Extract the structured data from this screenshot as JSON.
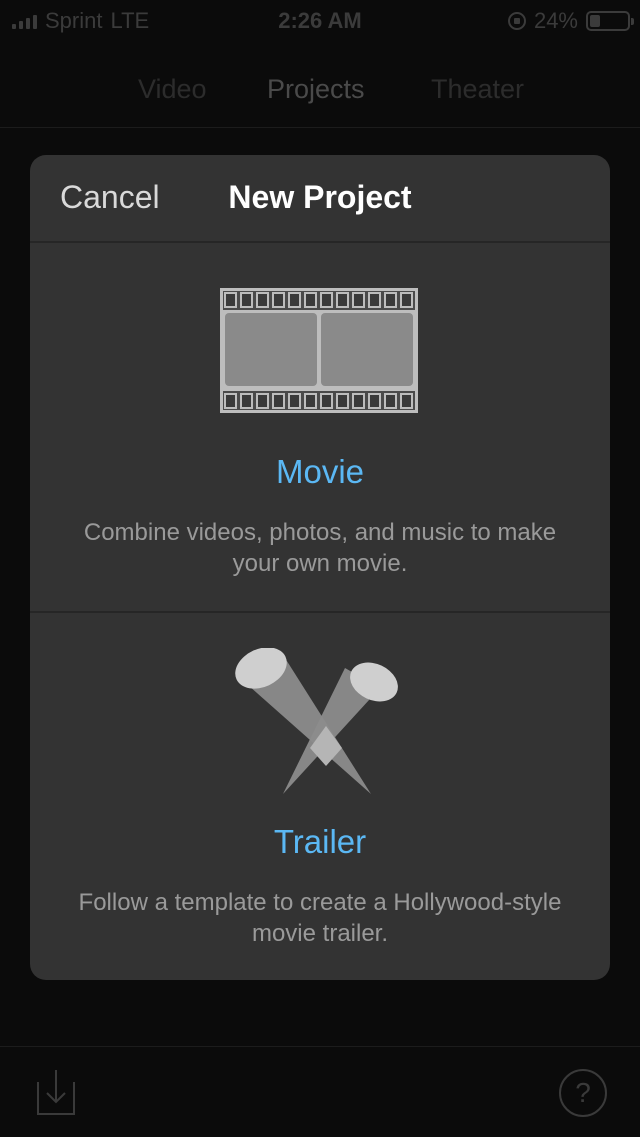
{
  "status_bar": {
    "carrier": "Sprint",
    "network": "LTE",
    "time": "2:26 AM",
    "battery_percent": "24%",
    "battery_level": 0.24
  },
  "top_nav": {
    "tabs": [
      {
        "label": "Video",
        "selected": false
      },
      {
        "label": "Projects",
        "selected": true
      },
      {
        "label": "Theater",
        "selected": false
      }
    ]
  },
  "modal": {
    "cancel_label": "Cancel",
    "title": "New Project",
    "options": [
      {
        "title": "Movie",
        "description": "Combine videos, photos, and music to make your own movie.",
        "icon": "film-strip-icon"
      },
      {
        "title": "Trailer",
        "description": "Follow a template to create a Hollywood-style movie trailer.",
        "icon": "spotlights-icon"
      }
    ],
    "accent_color": "#5bb8f4"
  },
  "bottom_bar": {
    "import_icon": "import-icon",
    "help_label": "?"
  }
}
